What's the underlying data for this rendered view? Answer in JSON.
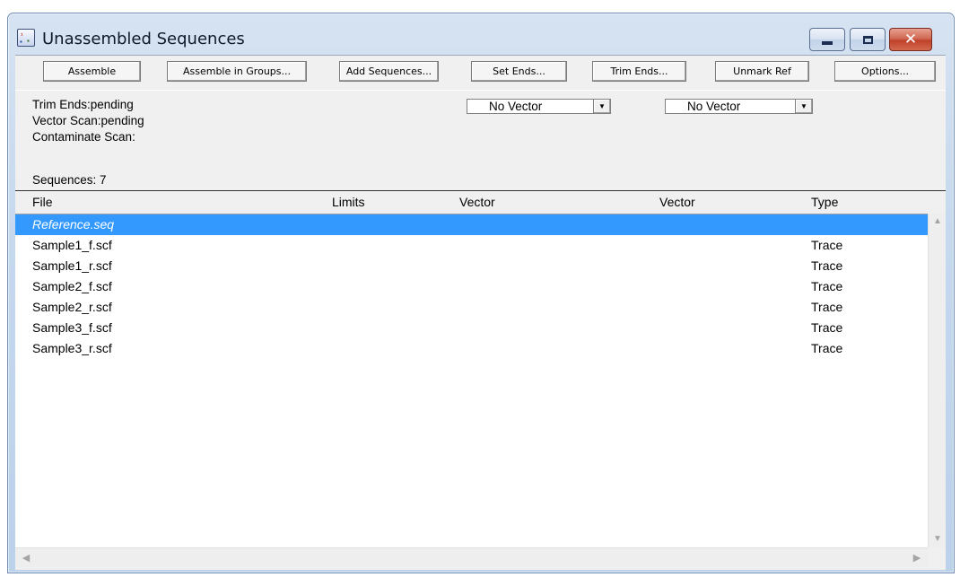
{
  "window": {
    "title": "Unassembled Sequences",
    "close_glyph": "✕"
  },
  "toolbar": {
    "buttons": [
      {
        "label": "Assemble"
      },
      {
        "label": "Assemble in Groups..."
      },
      {
        "label": "Add Sequences..."
      },
      {
        "label": "Set Ends..."
      },
      {
        "label": "Trim Ends..."
      },
      {
        "label": "Unmark Ref"
      },
      {
        "label": "Options..."
      }
    ]
  },
  "status": {
    "trim_ends": "Trim Ends:pending",
    "vector_scan": "Vector Scan:pending",
    "contaminate_scan": "Contaminate Scan:",
    "sequences_count": "Sequences: 7"
  },
  "vector_selects": [
    {
      "value": "No Vector"
    },
    {
      "value": "No Vector"
    }
  ],
  "columns": {
    "file": "File",
    "limits": "Limits",
    "vector1": "Vector",
    "vector2": "Vector",
    "type": "Type"
  },
  "rows": [
    {
      "file": "Reference.seq",
      "type": "",
      "selected": true
    },
    {
      "file": "Sample1_f.scf",
      "type": "Trace"
    },
    {
      "file": "Sample1_r.scf",
      "type": "Trace"
    },
    {
      "file": "Sample2_f.scf",
      "type": "Trace"
    },
    {
      "file": "Sample2_r.scf",
      "type": "Trace"
    },
    {
      "file": "Sample3_f.scf",
      "type": "Trace"
    },
    {
      "file": "Sample3_r.scf",
      "type": "Trace"
    }
  ],
  "colors": {
    "selection": "#3399ff",
    "close_button": "#c0412a"
  },
  "icons": {
    "app": "sequence-app-icon",
    "minimize": "minimize-icon",
    "maximize": "maximize-icon",
    "close": "close-icon",
    "dropdown": "chevron-down-icon"
  }
}
